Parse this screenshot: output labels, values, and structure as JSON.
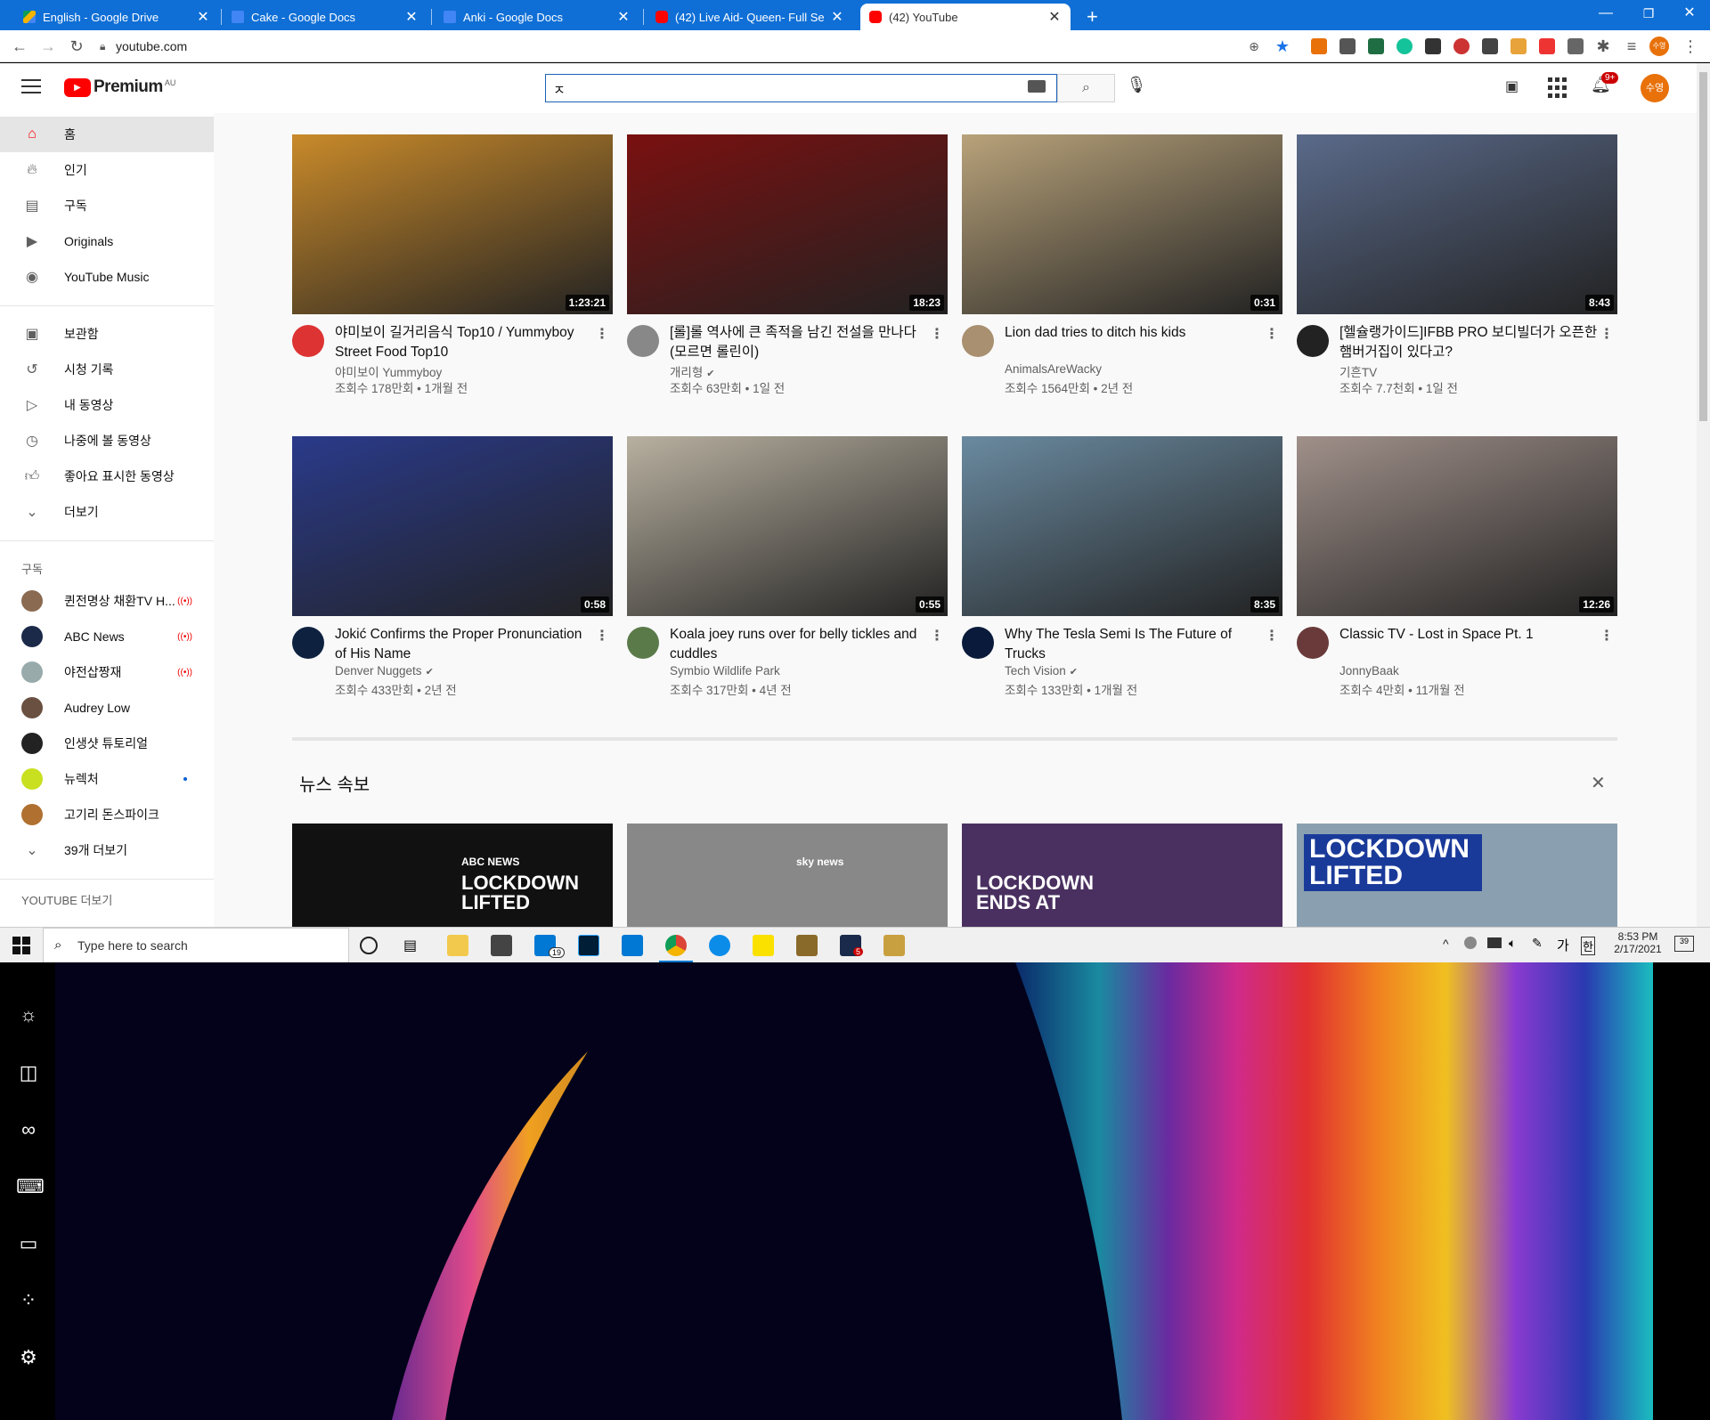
{
  "browser": {
    "tabs": [
      {
        "title": "English - Google Drive",
        "favicon": "drive-icon",
        "color": "#f4b400"
      },
      {
        "title": "Cake - Google Docs",
        "favicon": "docs-icon",
        "color": "#4285f4"
      },
      {
        "title": "Anki - Google Docs",
        "favicon": "docs-icon",
        "color": "#4285f4"
      },
      {
        "title": "(42) Live Aid- Queen- Full Se",
        "favicon": "youtube-icon",
        "color": "#ff0000"
      },
      {
        "title": "(42) YouTube",
        "favicon": "youtube-icon",
        "color": "#ff0000"
      }
    ],
    "url": "youtube.com",
    "profile_initials": "수영"
  },
  "youtube": {
    "logo_text": "Premium",
    "logo_region": "AU",
    "search_value": "ㅈ",
    "notification_count": "9+",
    "user_avatar": "수영",
    "sidebar": {
      "main": [
        {
          "label": "홈",
          "icon": "home-icon",
          "active": true
        },
        {
          "label": "인기",
          "icon": "trending-icon"
        },
        {
          "label": "구독",
          "icon": "subscriptions-icon"
        },
        {
          "label": "Originals",
          "icon": "originals-icon"
        },
        {
          "label": "YouTube Music",
          "icon": "music-icon"
        }
      ],
      "library": [
        {
          "label": "보관함",
          "icon": "library-icon"
        },
        {
          "label": "시청 기록",
          "icon": "history-icon"
        },
        {
          "label": "내 동영상",
          "icon": "your-videos-icon"
        },
        {
          "label": "나중에 볼 동영상",
          "icon": "watch-later-icon"
        },
        {
          "label": "좋아요 표시한 동영상",
          "icon": "liked-icon"
        },
        {
          "label": "더보기",
          "icon": "chevron-down-icon"
        }
      ],
      "subscriptions_heading": "구독",
      "subscriptions": [
        {
          "label": "퀸전명상 채환TV H...",
          "live": true,
          "color": "#8a6a50"
        },
        {
          "label": "ABC News",
          "live": true,
          "color": "#1c2a4a"
        },
        {
          "label": "야전삽짱재",
          "live": true,
          "color": "#9aa"
        },
        {
          "label": "Audrey Low",
          "live": false,
          "color": "#6a5040"
        },
        {
          "label": "인생샷 튜토리얼",
          "live": false,
          "color": "#222"
        },
        {
          "label": "뉴렉처",
          "live": false,
          "dot": true,
          "color": "#c8e020"
        },
        {
          "label": "고기리 돈스파이크",
          "live": false,
          "color": "#b07030"
        }
      ],
      "more_subs": "39개 더보기",
      "youtube_more": "YOUTUBE 더보기"
    },
    "videos": [
      {
        "title": "야미보이 길거리음식 Top10 / Yummyboy Street Food Top10",
        "channel": "야미보이 Yummyboy",
        "verified": false,
        "stats": "조회수 178만회 • 1개월 전",
        "duration": "1:23:21",
        "thumb_color": "#c98a2a",
        "avatar_color": "#d33"
      },
      {
        "title": "[롤]롤 역사에 큰 족적을 남긴 전설을 만나다 (모르면 롤린이)",
        "channel": "개리형",
        "verified": true,
        "stats": "조회수 63만회 • 1일 전",
        "duration": "18:23",
        "thumb_color": "#7a1010",
        "avatar_color": "#888"
      },
      {
        "title": "Lion dad tries to ditch his kids",
        "channel": "AnimalsAreWacky",
        "verified": false,
        "stats": "조회수 1564만회 • 2년 전",
        "duration": "0:31",
        "thumb_color": "#b8a27a",
        "avatar_color": "#a89070"
      },
      {
        "title": "[헬슐랭가이드]IFBB PRO 보디빌더가 오픈한 햄버거집이 있다고?",
        "channel": "기흔TV",
        "verified": false,
        "stats": "조회수 7.7천회 • 1일 전",
        "duration": "8:43",
        "thumb_color": "#5a6a8a",
        "avatar_color": "#222"
      },
      {
        "title": "Jokić Confirms the Proper Pronunciation of His Name",
        "channel": "Denver Nuggets",
        "verified": true,
        "stats": "조회수 433만회 • 2년 전",
        "duration": "0:58",
        "thumb_color": "#2a3a8a",
        "avatar_color": "#0e2240"
      },
      {
        "title": "Koala joey runs over for belly tickles and cuddles",
        "channel": "Symbio Wildlife Park",
        "verified": false,
        "stats": "조회수 317만회 • 4년 전",
        "duration": "0:55",
        "thumb_color": "#b8b0a0",
        "avatar_color": "#5a7a4a"
      },
      {
        "title": "Why The Tesla Semi Is The Future of Trucks",
        "channel": "Tech Vision",
        "verified": true,
        "stats": "조회수 133만회 • 1개월 전",
        "duration": "8:35",
        "thumb_color": "#6a8aa0",
        "avatar_color": "#0a1a3a"
      },
      {
        "title": "Classic TV - Lost in Space Pt. 1",
        "channel": "JonnyBaak",
        "verified": false,
        "stats": "조회수 4만회 • 11개월 전",
        "duration": "12:26",
        "thumb_color": "#a0908a",
        "avatar_color": "#6a3a3a"
      }
    ],
    "news_shelf": {
      "title": "뉴스 속보",
      "thumbs": [
        {
          "text_brand": "ABC NEWS",
          "text": "LOCKDOWN LIFTED",
          "color": "#111"
        },
        {
          "text_brand": "sky news",
          "text": "",
          "color": "#888"
        },
        {
          "text_brand": "",
          "text": "LOCKDOWN ENDS AT",
          "color": "#4a3060"
        },
        {
          "text_brand": "",
          "text": "LOCKDOWN LIFTED",
          "color": "#8aa0b0"
        }
      ]
    }
  },
  "taskbar": {
    "search_placeholder": "Type here to search",
    "time": "8:53 PM",
    "date": "2/17/2021",
    "ime": "가",
    "ime2": "한",
    "notif_count": "39",
    "mail_badge": "19",
    "app_badge": "5"
  }
}
